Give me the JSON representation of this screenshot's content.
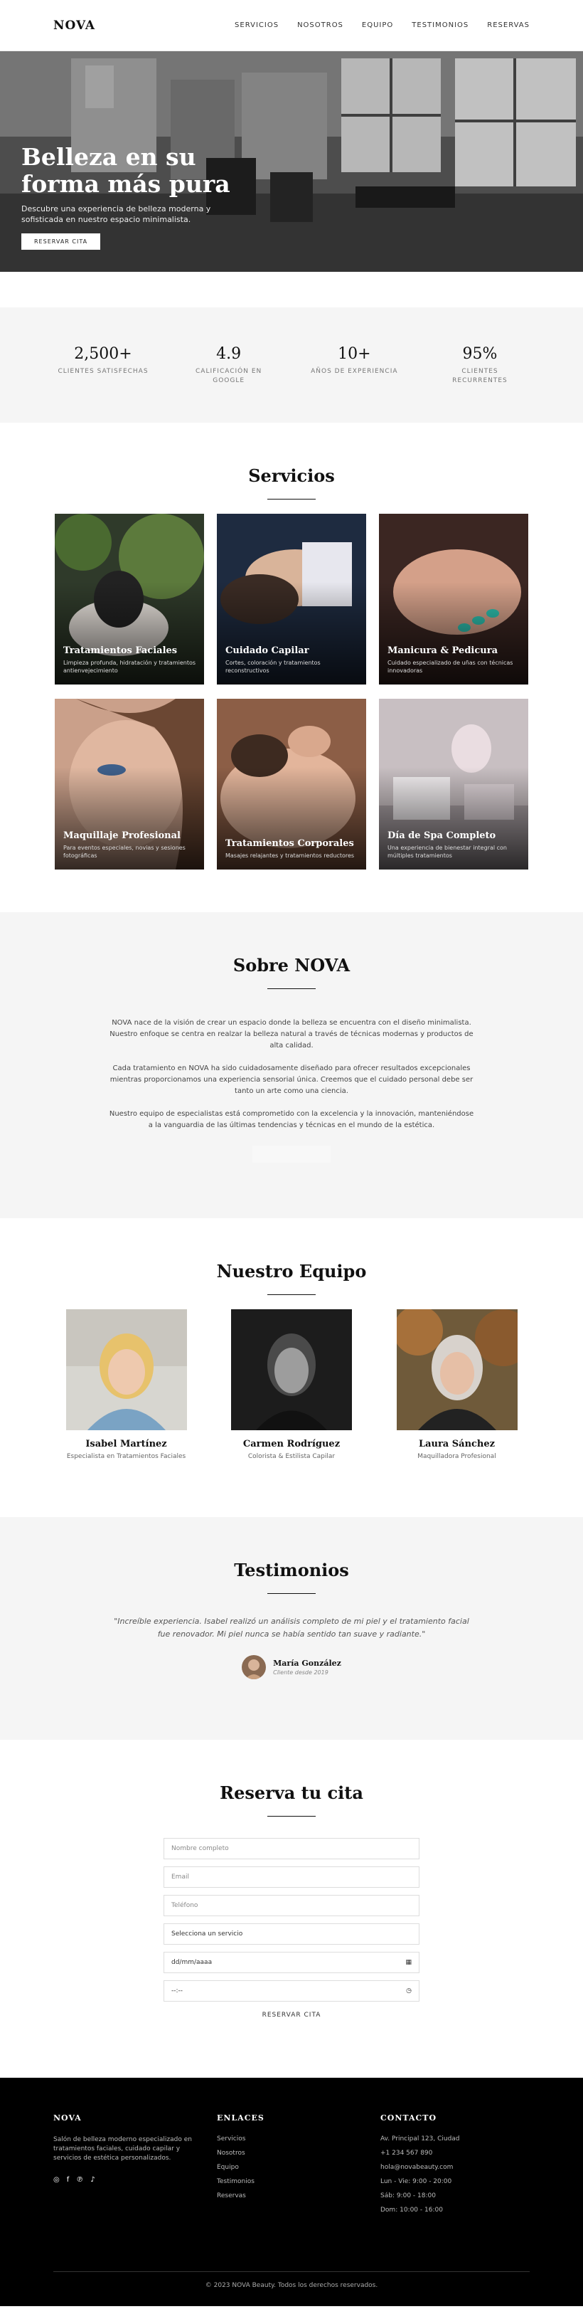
{
  "nav": {
    "brand": "NOVA",
    "items": [
      "SERVICIOS",
      "NOSOTROS",
      "EQUIPO",
      "TESTIMONIOS",
      "RESERVAS"
    ]
  },
  "hero": {
    "title": "Belleza en su forma más pura",
    "subtitle": "Descubre una experiencia de belleza moderna y sofisticada en nuestro espacio minimalista.",
    "cta": "RESERVAR CITA"
  },
  "stats": [
    {
      "value": "2,500+",
      "label": "CLIENTES SATISFECHAS"
    },
    {
      "value": "4.9",
      "label": "CALIFICACIÓN EN GOOGLE"
    },
    {
      "value": "10+",
      "label": "AÑOS DE EXPERIENCIA"
    },
    {
      "value": "95%",
      "label": "CLIENTES RECURRENTES"
    }
  ],
  "services": {
    "title": "Servicios",
    "items": [
      {
        "title": "Tratamientos Faciales",
        "desc": "Limpieza profunda, hidratación y tratamientos antienvejecimiento"
      },
      {
        "title": "Cuidado Capilar",
        "desc": "Cortes, coloración y tratamientos reconstructivos"
      },
      {
        "title": "Manicura & Pedicura",
        "desc": "Cuidado especializado de uñas con técnicas innovadoras"
      },
      {
        "title": "Maquillaje Profesional",
        "desc": "Para eventos especiales, novias y sesiones fotográficas"
      },
      {
        "title": "Tratamientos Corporales",
        "desc": "Masajes relajantes y tratamientos reductores"
      },
      {
        "title": "Día de Spa Completo",
        "desc": "Una experiencia de bienestar integral con múltiples tratamientos"
      }
    ]
  },
  "about": {
    "title": "Sobre NOVA",
    "paragraphs": [
      "NOVA nace de la visión de crear un espacio donde la belleza se encuentra con el diseño minimalista. Nuestro enfoque se centra en realzar la belleza natural a través de técnicas modernas y productos de alta calidad.",
      "Cada tratamiento en NOVA ha sido cuidadosamente diseñado para ofrecer resultados excepcionales mientras proporcionamos una experiencia sensorial única. Creemos que el cuidado personal debe ser tanto un arte como una ciencia.",
      "Nuestro equipo de especialistas está comprometido con la excelencia y la innovación, manteniéndose a la vanguardia de las últimas tendencias y técnicas en el mundo de la estética."
    ]
  },
  "team": {
    "title": "Nuestro Equipo",
    "members": [
      {
        "name": "Isabel Martínez",
        "role": "Especialista en Tratamientos Faciales"
      },
      {
        "name": "Carmen Rodríguez",
        "role": "Colorista & Estilista Capilar"
      },
      {
        "name": "Laura Sánchez",
        "role": "Maquilladora Profesional"
      }
    ]
  },
  "testimonials": {
    "title": "Testimonios",
    "quote": "\"Increíble experiencia. Isabel realizó un análisis completo de mi piel y el tratamiento facial fue renovador. Mi piel nunca se había sentido tan suave y radiante.\"",
    "author": "María González",
    "since": "Cliente desde 2019"
  },
  "reservation": {
    "title": "Reserva tu cita",
    "name_placeholder": "Nombre completo",
    "email_placeholder": "Email",
    "phone_placeholder": "Teléfono",
    "service_select": "Selecciona un servicio",
    "date_placeholder": "dd/mm/aaaa",
    "time_placeholder": "--:--",
    "submit": "RESERVAR CITA"
  },
  "footer": {
    "brand_title": "NOVA",
    "brand_desc": "Salón de belleza moderno especializado en tratamientos faciales, cuidado capilar y servicios de estética personalizados.",
    "links_title": "ENLACES",
    "links": [
      "Servicios",
      "Nosotros",
      "Equipo",
      "Testimonios",
      "Reservas"
    ],
    "contact_title": "CONTACTO",
    "contact": [
      "Av. Principal 123, Ciudad",
      "+1 234 567 890",
      "hola@novabeauty.com",
      "Lun - Vie: 9:00 - 20:00",
      "Sáb: 9:00 - 18:00",
      "Dom: 10:00 - 16:00"
    ],
    "copyright": "© 2023 NOVA Beauty. Todos los derechos reservados."
  },
  "icons": [
    "instagram-icon",
    "facebook-icon",
    "pinterest-icon",
    "tiktok-icon",
    "calendar-icon",
    "clock-icon"
  ]
}
